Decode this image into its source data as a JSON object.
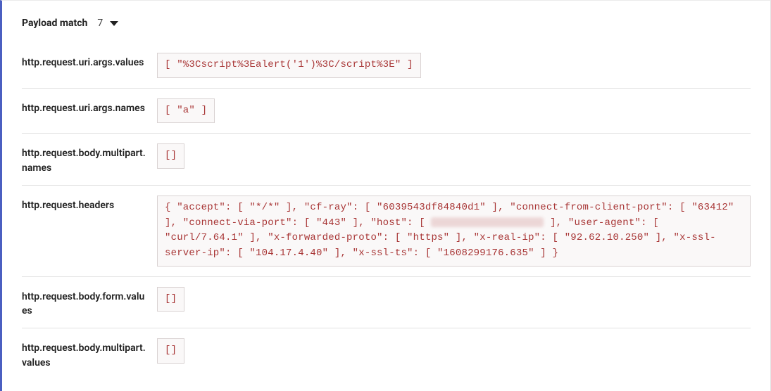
{
  "header": {
    "label": "Payload match",
    "count": "7"
  },
  "rows": [
    {
      "name": "http.request.uri.args.values",
      "value": "[ \"%3Cscript%3Ealert('1')%3C/script%3E\" ]",
      "full": false
    },
    {
      "name": "http.request.uri.args.names",
      "value": "[ \"a\" ]",
      "full": false
    },
    {
      "name": "http.request.body.multipart.names",
      "value": "[]",
      "full": false
    },
    {
      "name": "http.request.headers",
      "pre": "{ \"accept\": [ \"*/*\" ], \"cf-ray\": [ \"6039543df84840d1\" ], \"connect-from-client-port\": [ \"63412\" ], \"connect-via-port\": [ \"443\" ], \"host\": [ ",
      "post": " ], \"user-agent\": [ \"curl/7.64.1\" ], \"x-forwarded-proto\": [ \"https\" ], \"x-real-ip\": [ \"92.62.10.250\" ], \"x-ssl-server-ip\": [ \"104.17.4.40\" ], \"x-ssl-ts\": [ \"1608299176.635\" ] }",
      "full": true,
      "redacted": true
    },
    {
      "name": "http.request.body.form.values",
      "value": "[]",
      "full": false
    },
    {
      "name": "http.request.body.multipart.values",
      "value": "[]",
      "full": false
    }
  ]
}
